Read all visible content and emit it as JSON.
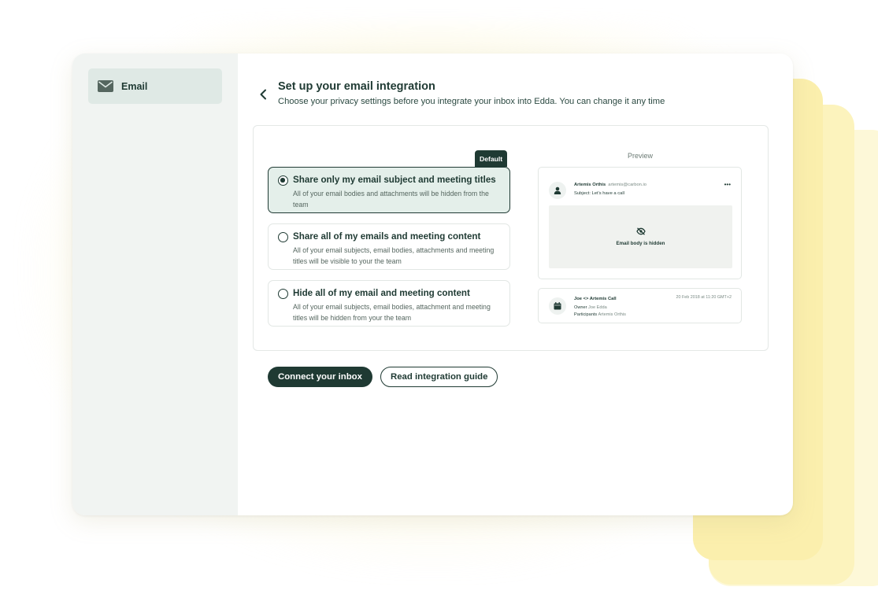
{
  "sidebar": {
    "items": [
      {
        "label": "Email",
        "icon": "envelope-icon",
        "active": true
      }
    ]
  },
  "header": {
    "title": "Set up your email integration",
    "subtitle": "Choose your privacy settings before you integrate your inbox into Edda. You can change it any time"
  },
  "options": [
    {
      "title": "Share only my email subject and meeting titles",
      "description": "All of your email bodies and attachments will be hidden from the team",
      "selected": true,
      "badge": "Default"
    },
    {
      "title": "Share all of my emails and meeting content",
      "description": "All of your email subjects, email bodies, attachments and meeting titles will be visible to your the team",
      "selected": false
    },
    {
      "title": "Hide all of my email and meeting content",
      "description": "All of your email subjects, email bodies, attachment and meeting titles will be hidden from your the team",
      "selected": false
    }
  ],
  "preview": {
    "label": "Preview",
    "email": {
      "sender_name": "Artemis Orthis",
      "sender_email": "artemis@carbon.io",
      "subject": "Subject: Let's have a call",
      "hidden_text": "Email body is hidden",
      "more_icon": "ellipsis-icon"
    },
    "meeting": {
      "title": "Joe <> Artemis Call",
      "date": "20 Feb 2018 at 11:20 GMT+2",
      "owner_label": "Owner",
      "owner": "Joe Edda",
      "participants_label": "Participants",
      "participants": "Artemis Orthis"
    }
  },
  "actions": {
    "connect_label": "Connect your inbox",
    "guide_label": "Read integration guide"
  },
  "colors": {
    "primary": "#1f3a33",
    "selected_bg": "#e4efea",
    "sidebar_bg": "#f1f4f2",
    "sidebar_active_bg": "#dfe9e5",
    "glow": "#fbefad"
  }
}
